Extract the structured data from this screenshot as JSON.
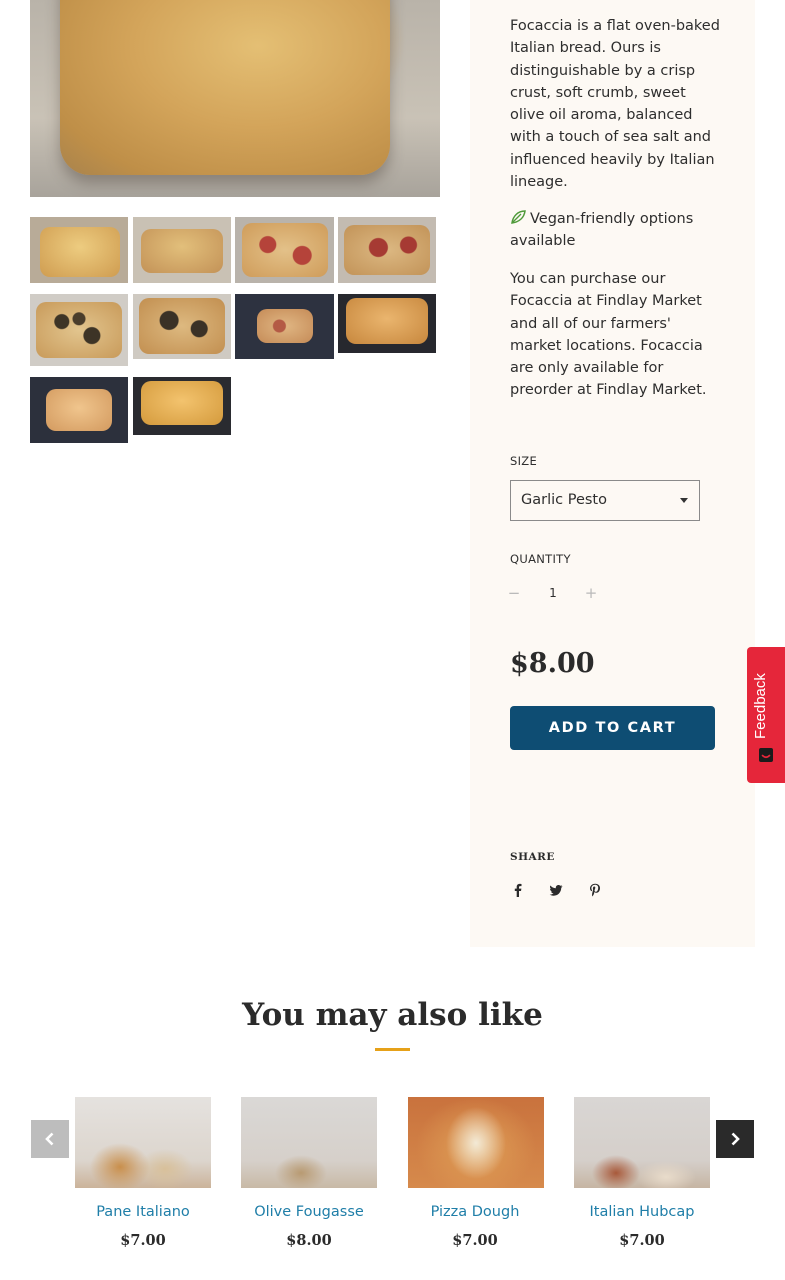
{
  "product": {
    "description": "Focaccia is a flat oven-baked Italian bread. Ours is distinguishable by a crisp crust, soft crumb, sweet olive oil aroma, balanced with a touch of sea salt and influenced heavily by Italian lineage.",
    "vegan_note": "Vegan-friendly options available",
    "availability": "You can purchase our Focaccia at Findlay Market and all of our farmers' market locations. Focaccia are only available for preorder at Findlay Market.",
    "size_label": "SIZE",
    "size_selected": "Garlic Pesto",
    "quantity_label": "QUANTITY",
    "quantity_minus": "−",
    "quantity_value": "1",
    "quantity_plus": "+",
    "price": "$8.00",
    "add_to_cart": "ADD TO CART",
    "share_label": "SHARE",
    "share_icons": [
      "facebook-icon",
      "twitter-icon",
      "pinterest-icon"
    ]
  },
  "gallery": {
    "thumbnail_count": 10
  },
  "feedback": {
    "label": "Feedback",
    "color": "#e5263a"
  },
  "related": {
    "title": "You may also like",
    "items": [
      {
        "name": "Pane Italiano",
        "price": "$7.00"
      },
      {
        "name": "Olive Fougasse",
        "price": "$8.00"
      },
      {
        "name": "Pizza Dough",
        "price": "$7.00"
      },
      {
        "name": "Italian Hubcap",
        "price": "$7.00"
      }
    ]
  },
  "colors": {
    "accent": "#0e4d73",
    "link": "#1f7ea8",
    "panel_bg": "#fdf9f4",
    "rule": "#e6a119"
  }
}
